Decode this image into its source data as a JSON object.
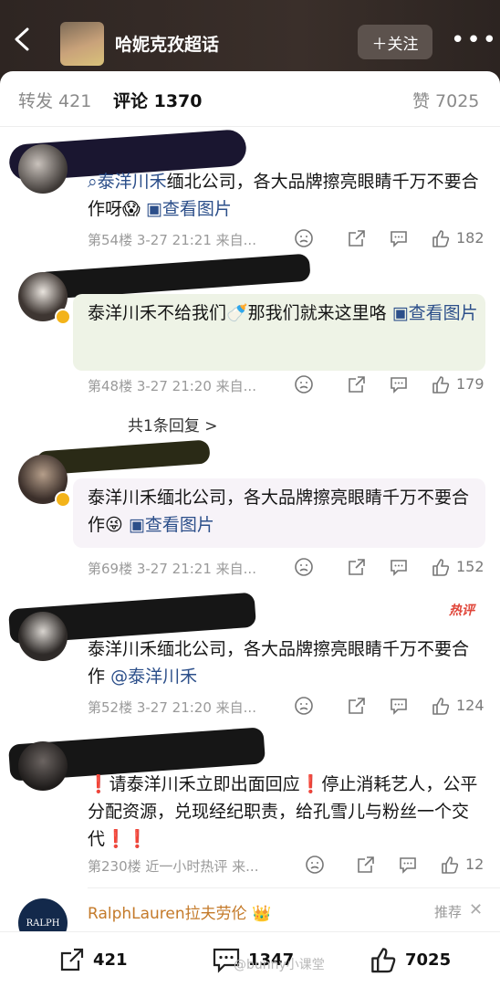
{
  "header": {
    "topic": "哈妮克孜超话",
    "follow_label": "＋关注"
  },
  "tabs": [
    {
      "label": "转发 421"
    },
    {
      "label": "评论 1370"
    },
    {
      "label": "赞 7025"
    }
  ],
  "comments": [
    {
      "text_link": "泰洋川禾",
      "text_rest": "缅北公司，各大品牌擦亮眼睛千万不要合作呀😱",
      "image_link": "查看图片",
      "meta": "第54楼 3-27 21:21 来自...",
      "likes": "182"
    },
    {
      "text_main": "泰洋川禾不给我们🍼那我们就来这里咯",
      "image_link": "查看图片",
      "meta": "第48楼 3-27 21:20 来自...",
      "likes": "179",
      "replies": "共1条回复 >"
    },
    {
      "text_main": "泰洋川禾缅北公司，各大品牌擦亮眼睛千万不要合作😜",
      "image_link": "查看图片",
      "meta": "第69楼 3-27 21:21 来自...",
      "likes": "152"
    },
    {
      "text_main": "泰洋川禾缅北公司，各大品牌擦亮眼睛千万不要合作",
      "mention": "@泰洋川禾",
      "badge": "热评",
      "meta": "第52楼 3-27 21:20 来自...",
      "likes": "124"
    },
    {
      "text_main": "❗请泰洋川禾立即出面回应❗停止消耗艺人，公平分配资源，兑现经纪职责，给孔雪儿与粉丝一个交代❗❗",
      "meta": "第230楼 近一小时热评 来...",
      "likes": "12"
    },
    {
      "name": "RalphLauren拉夫劳伦",
      "avatar_text": "RALPH",
      "recommend": "推荐"
    }
  ],
  "bottom": {
    "reposts": "421",
    "comments": "1347",
    "likes": "7025"
  },
  "watermark": "@bunny小课堂"
}
